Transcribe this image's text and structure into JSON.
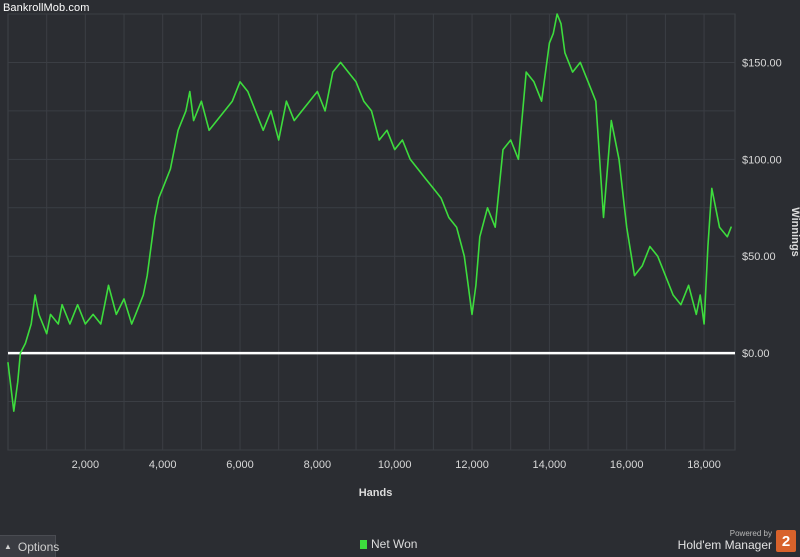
{
  "watermark": "BankrollMob.com",
  "options_label": "Options",
  "legend_label": "Net Won",
  "brand": {
    "powered": "Powered by",
    "name": "Hold'em Manager",
    "badge": "2",
    "badge_color": "#d8622b"
  },
  "colors": {
    "background": "#2b2d32",
    "grid": "#3b3e44",
    "series": "#3ddc3d",
    "zero_line": "#ffffff"
  },
  "chart_data": {
    "type": "line",
    "xlabel": "Hands",
    "ylabel": "Winnings",
    "xlim": [
      0,
      18800
    ],
    "ylim": [
      -50,
      175
    ],
    "x_ticks": [
      2000,
      4000,
      6000,
      8000,
      10000,
      12000,
      14000,
      16000,
      18000
    ],
    "x_tick_labels": [
      "2,000",
      "4,000",
      "6,000",
      "8,000",
      "10,000",
      "12,000",
      "14,000",
      "16,000",
      "18,000"
    ],
    "y_ticks": [
      0,
      50,
      100,
      150
    ],
    "y_tick_labels": [
      "$0.00",
      "$50.00",
      "$100.00",
      "$150.00"
    ],
    "grid": true,
    "legend_position": "bottom-center",
    "series": [
      {
        "name": "Net Won",
        "x": [
          0,
          150,
          250,
          320,
          450,
          600,
          700,
          800,
          900,
          1000,
          1100,
          1300,
          1400,
          1600,
          1800,
          2000,
          2200,
          2400,
          2500,
          2600,
          2800,
          3000,
          3200,
          3300,
          3500,
          3600,
          3800,
          3900,
          4000,
          4200,
          4400,
          4600,
          4700,
          4800,
          5000,
          5200,
          5400,
          5600,
          5800,
          6000,
          6200,
          6400,
          6600,
          6800,
          7000,
          7200,
          7400,
          7600,
          7800,
          8000,
          8200,
          8400,
          8600,
          8800,
          9000,
          9200,
          9400,
          9600,
          9800,
          10000,
          10200,
          10400,
          10600,
          10800,
          11000,
          11200,
          11400,
          11600,
          11800,
          11900,
          12000,
          12100,
          12200,
          12400,
          12600,
          12800,
          13000,
          13200,
          13400,
          13600,
          13800,
          14000,
          14100,
          14200,
          14300,
          14400,
          14600,
          14800,
          15000,
          15200,
          15400,
          15600,
          15800,
          16000,
          16200,
          16400,
          16600,
          16800,
          17000,
          17200,
          17400,
          17600,
          17800,
          17900,
          18000,
          18100,
          18200,
          18400,
          18600,
          18700
        ],
        "y": [
          -5,
          -30,
          -15,
          0,
          5,
          15,
          30,
          20,
          15,
          10,
          20,
          15,
          25,
          15,
          25,
          15,
          20,
          15,
          25,
          35,
          20,
          28,
          15,
          20,
          30,
          40,
          70,
          80,
          85,
          95,
          115,
          125,
          135,
          120,
          130,
          115,
          120,
          125,
          130,
          140,
          135,
          125,
          115,
          125,
          110,
          130,
          120,
          125,
          130,
          135,
          125,
          145,
          150,
          145,
          140,
          130,
          125,
          110,
          115,
          105,
          110,
          100,
          95,
          90,
          85,
          80,
          70,
          65,
          50,
          35,
          20,
          35,
          60,
          75,
          65,
          105,
          110,
          100,
          145,
          140,
          130,
          160,
          165,
          175,
          170,
          155,
          145,
          150,
          140,
          130,
          70,
          120,
          100,
          65,
          40,
          45,
          55,
          50,
          40,
          30,
          25,
          35,
          20,
          30,
          15,
          55,
          85,
          65,
          60,
          65
        ]
      }
    ]
  }
}
